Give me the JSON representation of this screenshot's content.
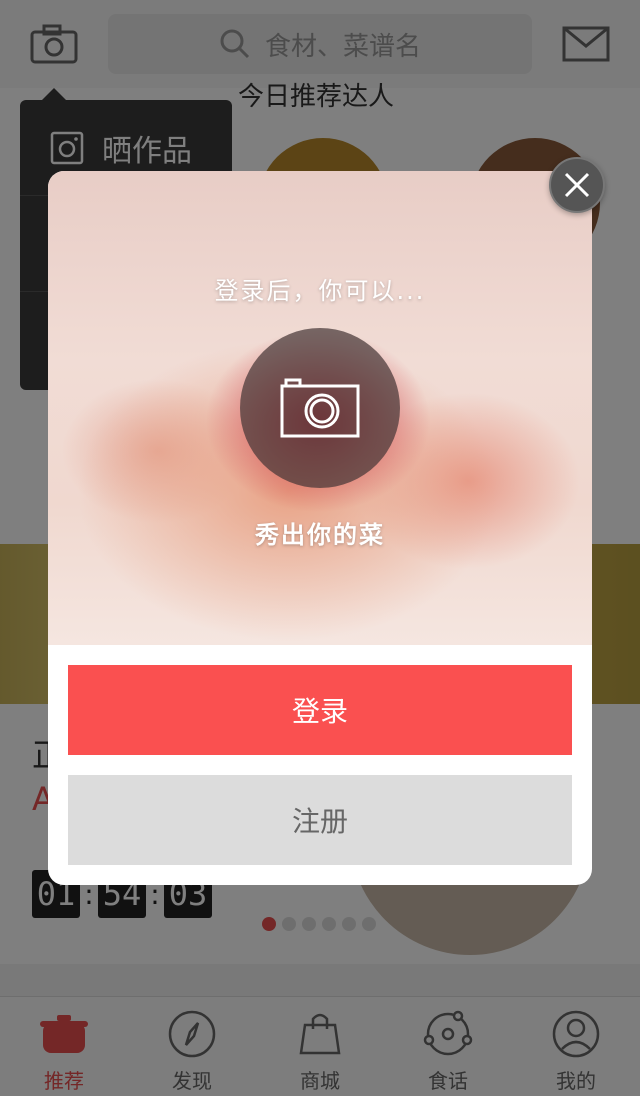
{
  "header": {
    "search_placeholder": "食材、菜谱名",
    "camera_icon": "camera-icon",
    "mail_icon": "mail-icon"
  },
  "recommend": {
    "section_title": "今日推荐达人"
  },
  "camera_menu": {
    "items": [
      {
        "label": "晒作品",
        "icon": "photo-icon"
      },
      {
        "label": "",
        "icon": ""
      },
      {
        "label": "",
        "icon": ""
      }
    ]
  },
  "deal": {
    "title": "正",
    "price_prefix": "A",
    "countdown": [
      "01",
      "54",
      "03"
    ]
  },
  "carousel": {
    "count": 6,
    "active_index": 0
  },
  "tabs": [
    {
      "label": "推荐",
      "icon": "pot-icon",
      "active": true
    },
    {
      "label": "发现",
      "icon": "compass-icon",
      "active": false
    },
    {
      "label": "商城",
      "icon": "shopping-bag-icon",
      "active": false
    },
    {
      "label": "食话",
      "icon": "chat-nodes-icon",
      "active": false
    },
    {
      "label": "我的",
      "icon": "user-icon",
      "active": false
    }
  ],
  "modal": {
    "hero_top_text": "登录后，你可以...",
    "hero_bottom_text": "秀出你的菜",
    "login_label": "登录",
    "register_label": "注册"
  },
  "colors": {
    "accent": "#fa5050",
    "secondary_button": "#dcdcdc",
    "overlay": "rgba(0,0,0,0.5)"
  }
}
